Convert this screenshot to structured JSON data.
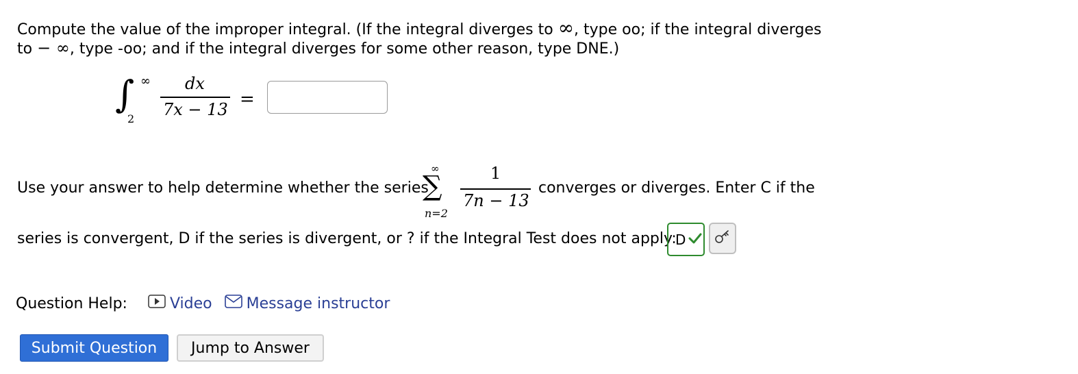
{
  "question": {
    "line1_a": "Compute the value of the improper integral. (If the integral diverges to",
    "line1_inf": "∞",
    "line1_b": ", type oo; if the integral diverges",
    "line2_a": "to",
    "line2_neginf": "− ∞",
    "line2_b": ", type -oo; and if the integral diverges for some other reason, type DNE.)"
  },
  "integral": {
    "sign": "∫",
    "upper": "∞",
    "lower": "2",
    "numerator": "dx",
    "denominator": "7x − 13",
    "equals": "="
  },
  "answer1": {
    "value": "",
    "placeholder": ""
  },
  "series": {
    "text_before": "Use your answer to help determine whether the series",
    "sigma": "∑",
    "upper": "∞",
    "lower": "n=2",
    "numerator": "1",
    "denominator": "7n − 13",
    "text_after": "converges or diverges. Enter C if the",
    "line2": "series is convergent, D if the series is divergent, or ? if the Integral Test does not apply:"
  },
  "answer2": {
    "value": "D",
    "status": "correct",
    "check": "✓"
  },
  "help": {
    "label": "Question Help:",
    "video": "Video",
    "message": "Message instructor"
  },
  "buttons": {
    "submit": "Submit Question",
    "jump": "Jump to Answer"
  },
  "colors": {
    "accent": "#2f6fd6",
    "link": "#2a3f95",
    "correct": "#2e8b2e"
  },
  "icons": {
    "video": "play-icon",
    "message": "envelope-icon",
    "key": "key-icon",
    "check": "checkmark-icon"
  }
}
